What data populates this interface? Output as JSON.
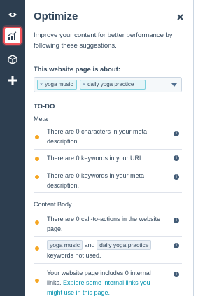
{
  "rail": {
    "items": [
      {
        "icon": "eye-icon"
      },
      {
        "icon": "chart-bars-icon"
      },
      {
        "icon": "cube-icon"
      },
      {
        "icon": "plus-icon"
      }
    ],
    "active_item": "chart-bars-icon",
    "accent": "#f2545b"
  },
  "panel": {
    "title": "Optimize",
    "intro": "Improve your content for better performance by following these suggestions.",
    "about_label": "This website page is about:",
    "topics": [
      "yoga music",
      "daily yoga practice"
    ],
    "todo_heading": "TO-DO",
    "sections": [
      {
        "label": "Meta",
        "items": [
          {
            "text": "There are 0 characters in your meta description."
          },
          {
            "text": "There are 0 keywords in your URL."
          },
          {
            "text": "There are 0 keywords in your meta description."
          }
        ]
      },
      {
        "label": "Content Body",
        "items": [
          {
            "text": "There are 0 call-to-actions in the website page."
          },
          {
            "keyword1": "yoga music",
            "joiner": "and",
            "keyword2": "daily yoga practice",
            "suffix": "keywords not used."
          },
          {
            "text": "Your website page includes 0 internal links.",
            "link": "Explore some internal links you might use in this page."
          }
        ]
      }
    ],
    "status_color": "#f5a623",
    "link_color": "#0091ae"
  }
}
